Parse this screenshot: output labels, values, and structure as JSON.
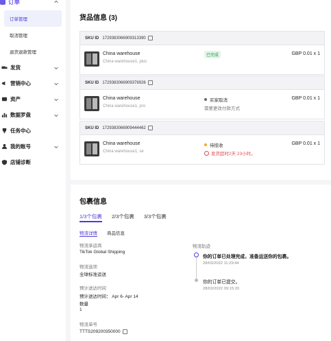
{
  "sidebar": {
    "order_label": "订单",
    "sub_items": [
      "订单管理",
      "取消管理",
      "退货退款管理"
    ],
    "nav_items": [
      {
        "label": "发货",
        "icon": "truck-icon",
        "chevron": true
      },
      {
        "label": "营销中心",
        "icon": "megaphone-icon",
        "chevron": true
      },
      {
        "label": "资产",
        "icon": "wallet-icon",
        "chevron": true
      },
      {
        "label": "数据罗盘",
        "icon": "chart-icon",
        "chevron": true
      },
      {
        "label": "任务中心",
        "icon": "trophy-icon",
        "chevron": false
      },
      {
        "label": "我的账号",
        "icon": "user-icon",
        "chevron": true
      },
      {
        "label": "店铺诊断",
        "icon": "shield-icon",
        "chevron": false
      }
    ]
  },
  "goods": {
    "title": "货品信息 (3)",
    "sku_label": "SKU ID",
    "items": [
      {
        "sku_id": "1729383066909313390",
        "name": "China warehouse",
        "variant": "China warehouse1, plus",
        "status": "已完成",
        "sub_status": "",
        "price": "GBP 0.01 x 1"
      },
      {
        "sku_id": "1729383066909378926",
        "name": "China warehouse",
        "variant": "China warehouse1, pro",
        "status": "买家取消",
        "sub_status": "需要更改付款方式",
        "price": "GBP 0.01 x 1"
      },
      {
        "sku_id": "1729383066909444462",
        "name": "China warehouse",
        "variant": "China warehouse1, se",
        "status": "待揽收",
        "sub_status": "发货超时2天 23小时。",
        "price": "GBP 0.01 x 1"
      }
    ]
  },
  "package": {
    "title": "包裹信息",
    "tabs": [
      "1/3个包裹",
      "2/3个包裹",
      "3/3个包裹"
    ],
    "subtabs": [
      "物流详情",
      "商品信息"
    ],
    "carrier_label": "物流承运商",
    "carrier": "TikTok Global Shipping",
    "option_label": "物流选项",
    "option": "全球标准运送",
    "eta_label": "预计送达时间",
    "eta": "预计送达时间： Apr 6- Apr 14",
    "qty_label": "数量",
    "qty": "1",
    "tracking_label": "物流单号",
    "tracking": "TTTS209200350000",
    "track_title": "物流轨迹",
    "events": [
      {
        "text": "你的订单已处理完成，准备运送你的包裹。",
        "time": "28/03/2022 11:29:44"
      },
      {
        "text": "你的订单已提交。",
        "time": "28/03/2022 09:15:20"
      }
    ]
  },
  "colors": {
    "accent": "#4b3ad6",
    "success": "#2a9a4a",
    "danger": "#e5484d",
    "warning": "#f5a623"
  }
}
